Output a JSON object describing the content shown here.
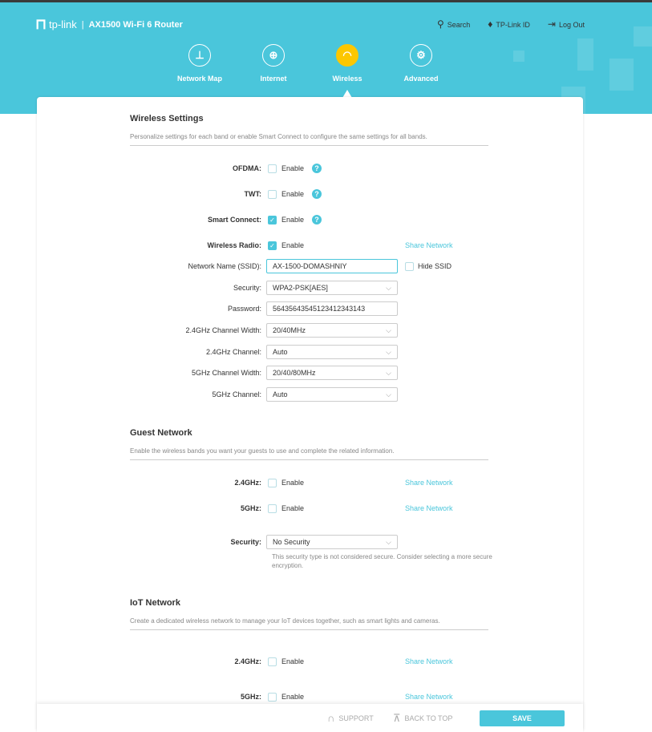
{
  "header": {
    "brand": "tp-link",
    "model": "AX1500 Wi-Fi 6 Router",
    "links": [
      {
        "label": "Search",
        "icon": "search-icon"
      },
      {
        "label": "TP-Link ID",
        "icon": "user-icon"
      },
      {
        "label": "Log Out",
        "icon": "logout-icon"
      }
    ]
  },
  "nav": [
    {
      "label": "Network Map",
      "icon": "network-map-icon"
    },
    {
      "label": "Internet",
      "icon": "globe-icon"
    },
    {
      "label": "Wireless",
      "icon": "wifi-icon",
      "active": true
    },
    {
      "label": "Advanced",
      "icon": "gear-icon"
    }
  ],
  "wireless": {
    "title": "Wireless Settings",
    "desc": "Personalize settings for each band or enable Smart Connect to configure the same settings for all bands.",
    "ofdma": {
      "label": "OFDMA:",
      "text": "Enable",
      "checked": false
    },
    "twt": {
      "label": "TWT:",
      "text": "Enable",
      "checked": false
    },
    "smart": {
      "label": "Smart Connect:",
      "text": "Enable",
      "checked": true
    },
    "radio": {
      "label": "Wireless Radio:",
      "text": "Enable",
      "checked": true,
      "share": "Share Network"
    },
    "ssid": {
      "label": "Network Name (SSID):",
      "value": "AX-1500-DOMASHNIY",
      "hide": "Hide SSID"
    },
    "security": {
      "label": "Security:",
      "value": "WPA2-PSK[AES]"
    },
    "password": {
      "label": "Password:",
      "value": "5643564354512341234314 3"
    },
    "cw24": {
      "label": "2.4GHz Channel Width:",
      "value": "20/40MHz"
    },
    "ch24": {
      "label": "2.4GHz Channel:",
      "value": "Auto"
    },
    "cw5": {
      "label": "5GHz Channel Width:",
      "value": "20/40/80MHz"
    },
    "ch5": {
      "label": "5GHz Channel:",
      "value": "Auto"
    }
  },
  "guest": {
    "title": "Guest Network",
    "desc": "Enable the wireless bands you want your guests to use and complete the related information.",
    "b24": {
      "label": "2.4GHz:",
      "text": "Enable",
      "share": "Share Network"
    },
    "b5": {
      "label": "5GHz:",
      "text": "Enable",
      "share": "Share Network"
    },
    "security": {
      "label": "Security:",
      "value": "No Security",
      "note": "This security type is not considered secure. Consider selecting a more secure encryption."
    }
  },
  "iot": {
    "title": "IoT Network",
    "desc": "Create a dedicated wireless network to manage your IoT devices together, such as smart lights and cameras.",
    "b24": {
      "label": "2.4GHz:",
      "text": "Enable",
      "share": "Share Network"
    },
    "b5": {
      "label": "5GHz:",
      "text": "Enable",
      "share": "Share Network"
    }
  },
  "footer": {
    "support": "SUPPORT",
    "top": "BACK TO TOP",
    "save": "SAVE"
  }
}
